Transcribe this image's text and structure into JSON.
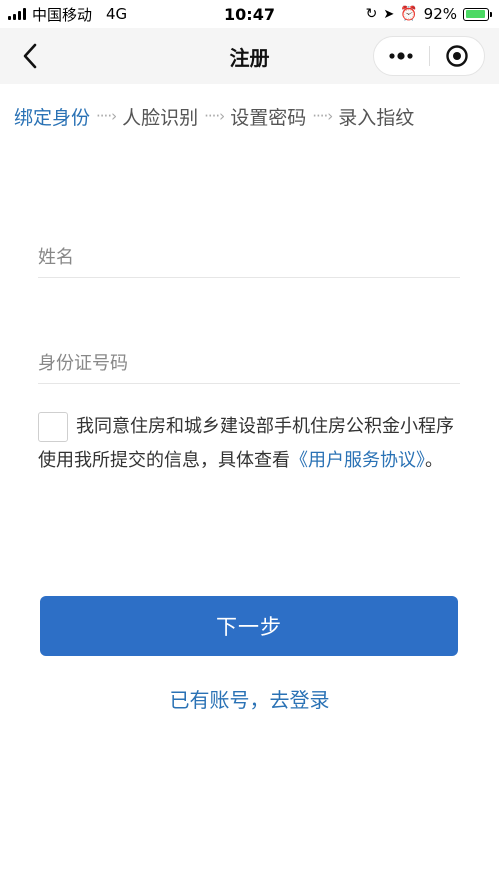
{
  "status_bar": {
    "carrier": "中国移动",
    "network": "4G",
    "time": "10:47",
    "battery": "92%",
    "battery_level": 0.92
  },
  "nav": {
    "title": "注册",
    "more_icon": "ellipsis-icon",
    "target_icon": "target-icon"
  },
  "steps": [
    {
      "label": "绑定身份"
    },
    {
      "label": "人脸识别"
    },
    {
      "label": "设置密码"
    },
    {
      "label": "录入指纹"
    }
  ],
  "form": {
    "name_placeholder": "姓名",
    "id_placeholder": "身份证号码"
  },
  "agreement": {
    "text": "我同意住房和城乡建设部手机住房公积金小程序使用我所提交的信息，具体查看",
    "link": "《用户服务协议》",
    "suffix": "。"
  },
  "next_button": "下一步",
  "login_link": "已有账号，去登录",
  "colors": {
    "accent": "#2a72b5",
    "button": "#2d6fc6",
    "nav_bg": "#f5f5f5"
  }
}
